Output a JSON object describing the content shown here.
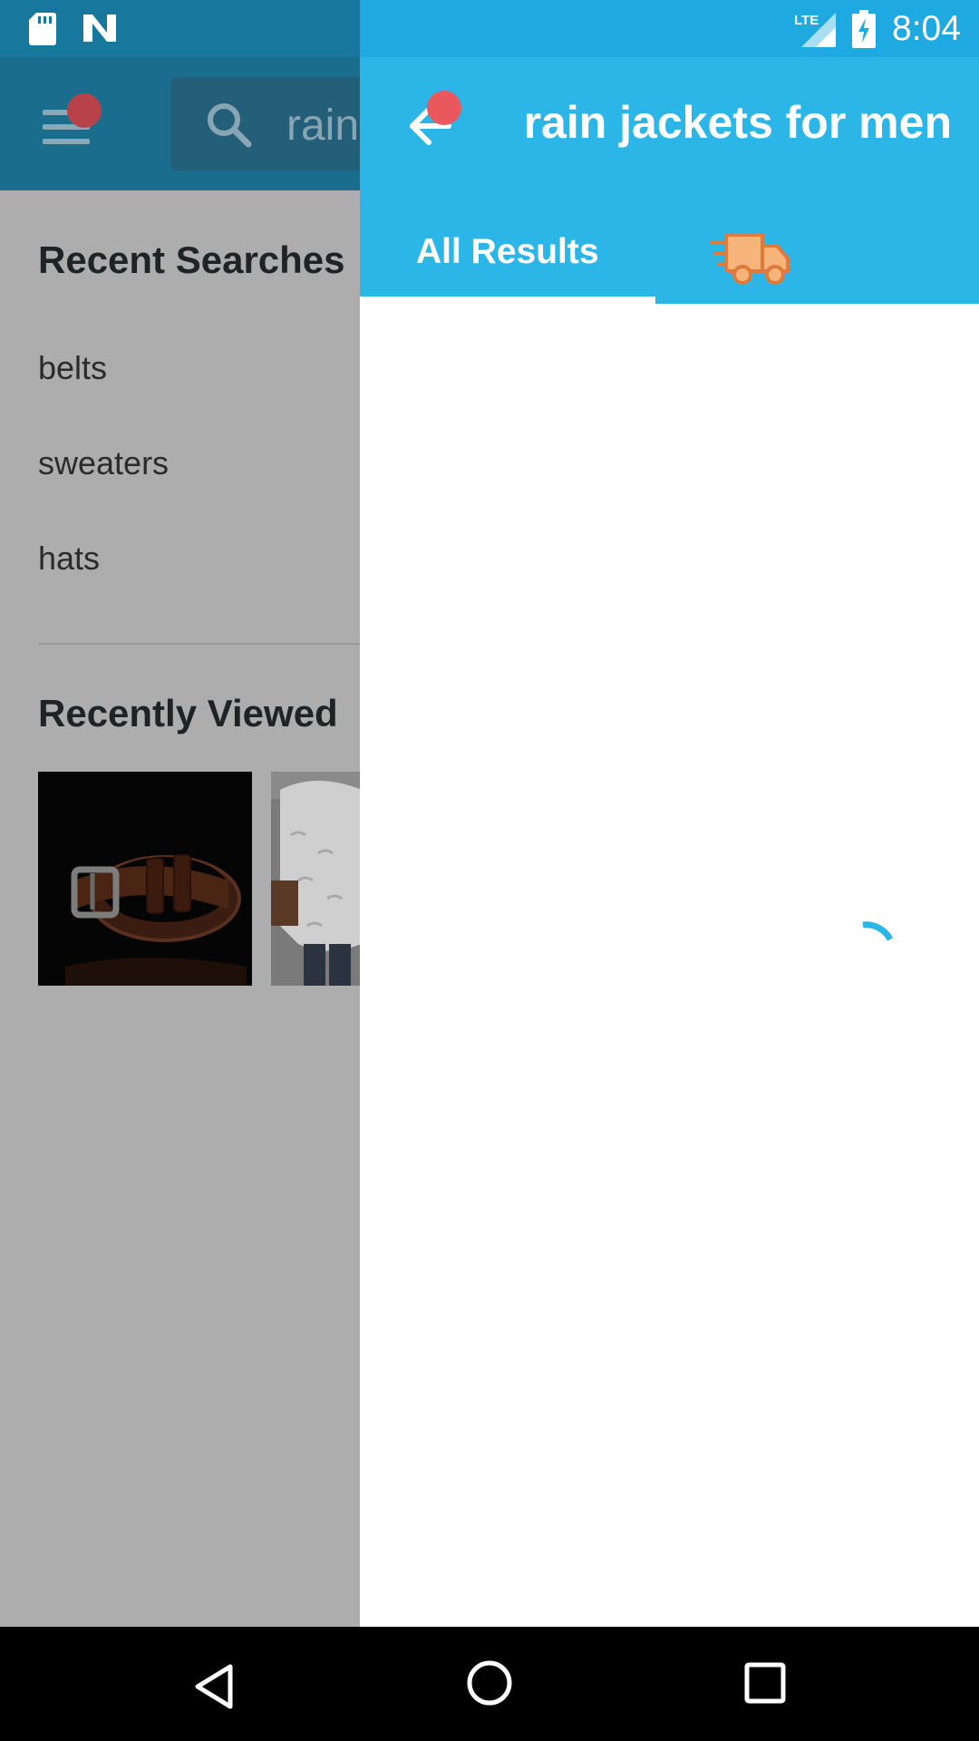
{
  "status_bar": {
    "time": "8:04",
    "network_label": "LTE",
    "icons": [
      "sd-card-icon",
      "n-notification-icon",
      "lte-signal-icon",
      "battery-charging-icon"
    ]
  },
  "background_screen": {
    "search": {
      "value": "rain",
      "icon": "search-icon"
    },
    "recent_searches": {
      "title": "Recent Searches",
      "items": [
        "belts",
        "sweaters",
        "hats"
      ]
    },
    "recently_viewed": {
      "title": "Recently Viewed",
      "items": [
        "belt-product-image",
        "sweater-product-image"
      ]
    }
  },
  "results_panel": {
    "query": "rain jackets for men",
    "tabs": [
      {
        "label": "All Results",
        "selected": true
      },
      {
        "icon": "fast-shipping-truck-icon",
        "selected": false
      }
    ],
    "loading": true
  },
  "colors": {
    "appbar": "#2cb6e8",
    "status_bar": "#1ea9e0",
    "badge": "#e8585d",
    "truck": "#f7b47a",
    "spinner": "#2cb6e8"
  },
  "nav_bar": {
    "buttons": [
      "back-triangle-icon",
      "home-circle-icon",
      "recents-square-icon"
    ]
  }
}
